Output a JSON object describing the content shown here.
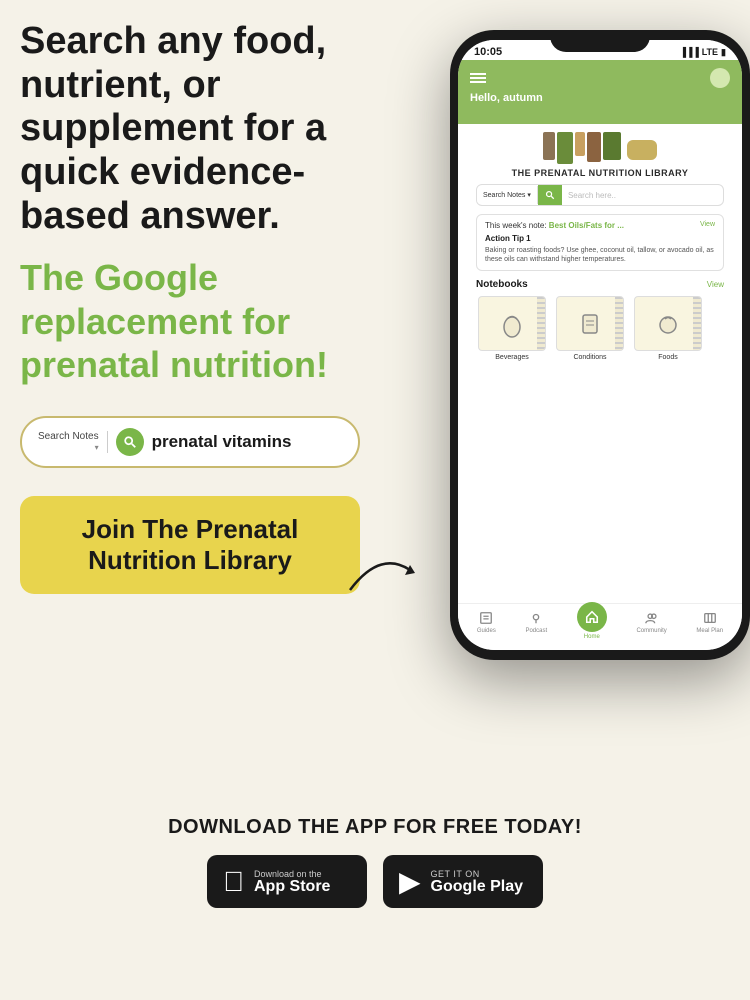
{
  "background_color": "#f5f2e8",
  "headline": "Search any food, nutrient, or supplement for a quick evidence-based answer.",
  "subheadline": "The Google replacement for prenatal nutrition!",
  "search_bar": {
    "dropdown_label": "Search Notes",
    "placeholder": "prenatal vitamins",
    "icon": "search-icon"
  },
  "cta_button": {
    "line1": "Join The Prenatal",
    "line2": "Nutrition Library"
  },
  "download_title": "DOWNLOAD THE APP FOR FREE TODAY!",
  "app_store": {
    "sub": "Download on the",
    "name": "App Store"
  },
  "google_play": {
    "sub": "GET IT ON",
    "name": "Google Play"
  },
  "phone": {
    "time": "10:05",
    "signal": "LTE",
    "greeting": "Hello, autumn",
    "library_title": "THE PRENATAL NUTRITION LIBRARY",
    "search": {
      "dropdown": "Search Notes",
      "placeholder": "Search here.."
    },
    "weekly_note": {
      "label": "This week's note:",
      "title": "Best Oils/Fats for ...",
      "view": "View"
    },
    "action_tip": {
      "title": "Action Tip 1",
      "text": "Baking or roasting foods? Use ghee, coconut oil, tallow, or avocado oil, as these oils can withstand higher temperatures."
    },
    "notebooks": {
      "title": "Notebooks",
      "view": "View",
      "items": [
        {
          "label": "Beverages"
        },
        {
          "label": "Conditions"
        },
        {
          "label": "Foods"
        }
      ]
    },
    "nav": [
      {
        "label": "Guides",
        "active": false
      },
      {
        "label": "Podcast",
        "active": false
      },
      {
        "label": "Home",
        "active": true
      },
      {
        "label": "Community",
        "active": false
      },
      {
        "label": "Meal Plan",
        "active": false
      }
    ]
  }
}
